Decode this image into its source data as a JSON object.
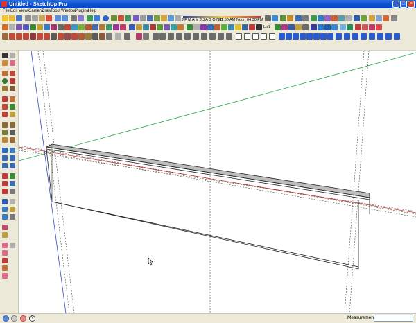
{
  "window": {
    "title": "Untitled - SketchUp Pro",
    "minimize": "_",
    "maximize": "□",
    "close": "×"
  },
  "menu": [
    "File",
    "Edit",
    "View",
    "Camera",
    "Draw",
    "Tools",
    "Window",
    "Plugins",
    "Help"
  ],
  "toolbar_text": {
    "time": "07:50 AM",
    "noon": "Noon",
    "time2": "04:30 PM",
    "months": "J F M A M J J A S O N D",
    "loft_label": "Loft"
  },
  "status": {
    "measurements_label": "Measurements",
    "measurements_value": "",
    "help_icon": "?"
  },
  "icons": [
    "pencil-icon",
    "line-icon",
    "arc-icon",
    "rectangle-icon",
    "circle-icon",
    "polygon-icon",
    "eraser-icon",
    "paint-bucket-icon",
    "push-pull-icon",
    "move-icon",
    "rotate-icon",
    "scale-icon",
    "offset-icon",
    "tape-measure-icon",
    "protractor-icon",
    "axes-icon",
    "dimension-icon",
    "text-icon",
    "section-icon",
    "orbit-icon",
    "pan-icon",
    "zoom-icon",
    "zoom-extents-icon",
    "walk-icon",
    "look-around-icon",
    "position-camera-icon",
    "select-arrow-icon",
    "help-icon"
  ],
  "colors": {
    "titlebar": "#0b4fd0",
    "chrome": "#ece9d8",
    "viewport": "#ffffff",
    "green_axis": "#2aa84a",
    "red_axis": "#c0312a",
    "blue_axis": "#3a46c9"
  }
}
